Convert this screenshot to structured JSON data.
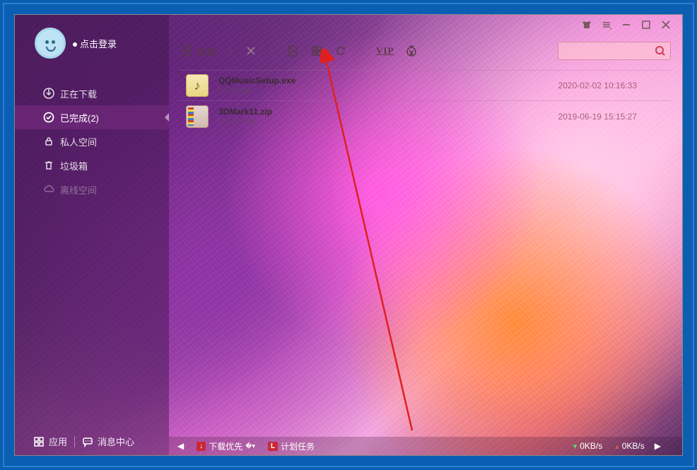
{
  "sidebar": {
    "login_label": "点击登录",
    "items": [
      {
        "label": "正在下载"
      },
      {
        "label": "已完成(2)"
      },
      {
        "label": "私人空间"
      },
      {
        "label": "垃圾箱"
      },
      {
        "label": "离线空间"
      }
    ],
    "bottom": {
      "apps_label": "应用",
      "messages_label": "消息中心"
    }
  },
  "toolbar": {
    "new_label": "新建",
    "vip_label": "VIP"
  },
  "files": [
    {
      "name": "QQMusicSetup.exe",
      "size": "52.58 MB",
      "date": "2020-02-02 10:16:33",
      "kind": "exe"
    },
    {
      "name": "3DMark11.zip",
      "size": "259.27 MB",
      "date": "2019-06-19 15:15:27",
      "kind": "zip"
    }
  ],
  "statusbar": {
    "priority_label": "下载优先",
    "tasks_label": "计划任务",
    "down_speed": "0KB/s",
    "up_speed": "0KB/s"
  },
  "colors": {
    "accent_red": "#c82838",
    "search_icon": "#d03a5a"
  }
}
